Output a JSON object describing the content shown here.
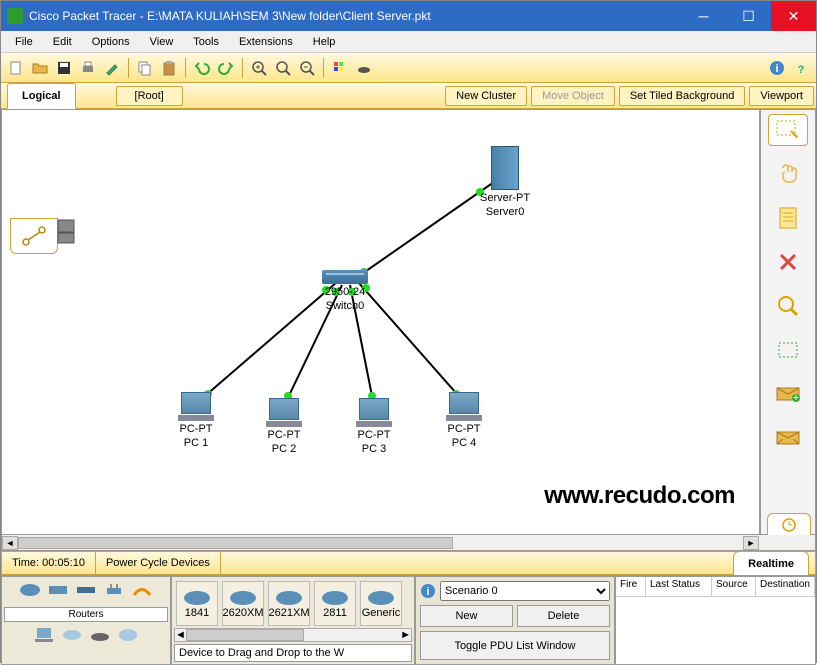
{
  "title": "Cisco Packet Tracer - E:\\MATA KULIAH\\SEM 3\\New folder\\Client Server.pkt",
  "menu": {
    "file": "File",
    "edit": "Edit",
    "options": "Options",
    "view": "View",
    "tools": "Tools",
    "extensions": "Extensions",
    "help": "Help"
  },
  "nav": {
    "logical": "Logical",
    "root": "[Root]",
    "new_cluster": "New Cluster",
    "move_object": "Move Object",
    "tiled_bg": "Set Tiled Background",
    "viewport": "Viewport"
  },
  "devices": {
    "server": {
      "type": "Server-PT",
      "name": "Server0"
    },
    "switch": {
      "type": "2950-24",
      "name": "Switch0"
    },
    "pc1": {
      "type": "PC-PT",
      "name": "PC 1"
    },
    "pc2": {
      "type": "PC-PT",
      "name": "PC 2"
    },
    "pc3": {
      "type": "PC-PT",
      "name": "PC 3"
    },
    "pc4": {
      "type": "PC-PT",
      "name": "PC 4"
    }
  },
  "watermark": "www.recudo.com",
  "status": {
    "time_label": "Time: 00:05:10",
    "power_cycle": "Power Cycle Devices",
    "realtime": "Realtime"
  },
  "devcat": {
    "label": "Routers"
  },
  "devlist": {
    "items": [
      "1841",
      "2620XM",
      "2621XM",
      "2811",
      "Generic"
    ],
    "drag_msg": "Device to Drag and Drop to the W"
  },
  "scenario": {
    "selected": "Scenario 0",
    "new": "New",
    "delete": "Delete",
    "toggle": "Toggle PDU List Window"
  },
  "pdutable": {
    "cols": [
      "Fire",
      "Last Status",
      "Source",
      "Destination"
    ]
  }
}
